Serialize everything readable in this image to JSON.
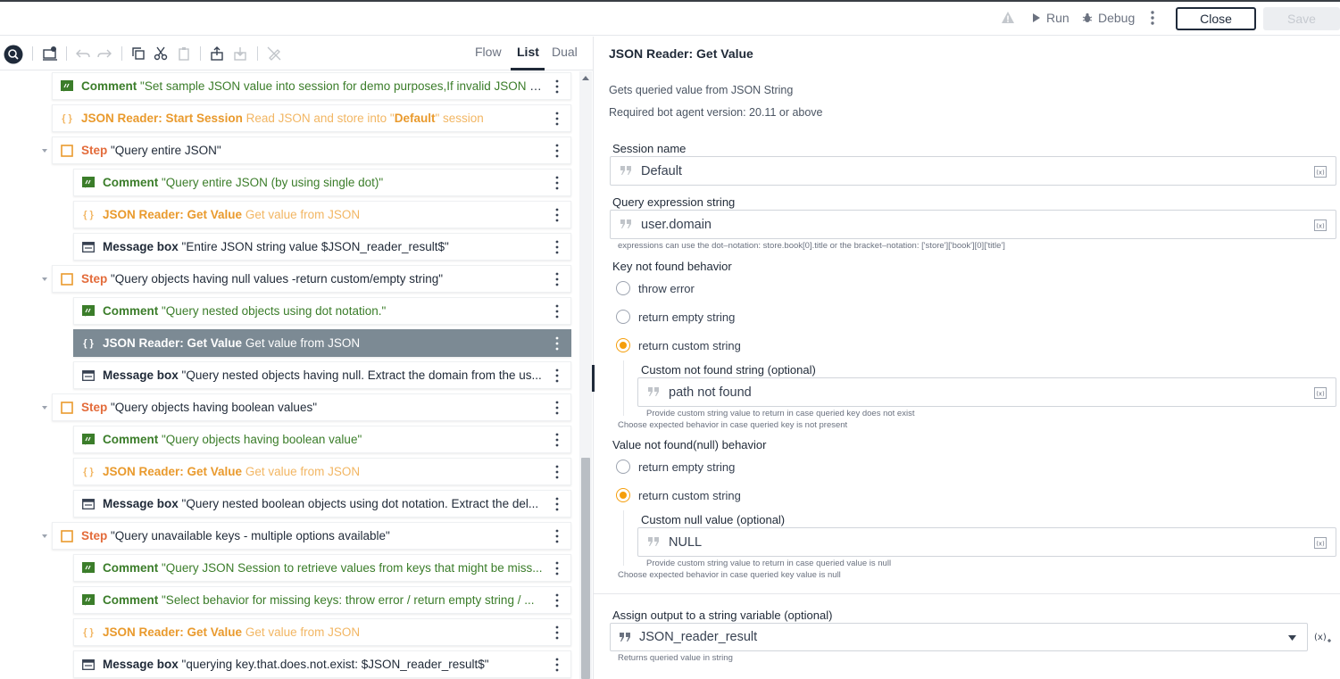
{
  "topbar": {
    "run_label": "Run",
    "debug_label": "Debug",
    "close_label": "Close",
    "save_label": "Save"
  },
  "view_tabs": [
    "Flow",
    "List",
    "Dual"
  ],
  "actions": [
    {
      "type": "comment",
      "label": "Comment",
      "detail": "\"Set sample JSON value into session for demo purposes,If invalid JSON i...\""
    },
    {
      "type": "json",
      "label": "JSON Reader: Start Session",
      "detail_pre": " Read JSON and store into \"",
      "detail_bold": "Default",
      "detail_post": "\" session"
    },
    {
      "type": "step",
      "label": "Step",
      "detail": " \"Query entire JSON\""
    },
    {
      "type": "comment",
      "label": "Comment",
      "detail": " \"Query entire JSON (by using single dot)\""
    },
    {
      "type": "json",
      "label": "JSON Reader: Get Value",
      "detail": " Get value from JSON"
    },
    {
      "type": "msg",
      "label": "Message box",
      "detail": " \"Entire JSON string value $JSON_reader_result$\""
    },
    {
      "type": "step",
      "label": "Step",
      "detail": " \"Query objects having null values -return custom/empty string\""
    },
    {
      "type": "comment",
      "label": "Comment",
      "detail": " \"Query nested objects using dot notation.\""
    },
    {
      "type": "json-selected",
      "label": "JSON Reader: Get Value",
      "detail": " Get value from JSON"
    },
    {
      "type": "msg",
      "label": "Message box",
      "detail": " \"Query nested objects having null. Extract the domain from the us..."
    },
    {
      "type": "step",
      "label": "Step",
      "detail": " \"Query objects having boolean values\""
    },
    {
      "type": "comment",
      "label": "Comment",
      "detail": " \"Query objects having boolean value\""
    },
    {
      "type": "json",
      "label": "JSON Reader: Get Value",
      "detail": " Get value from JSON"
    },
    {
      "type": "msg",
      "label": "Message box",
      "detail": " \"Query nested boolean objects using dot notation. Extract the del..."
    },
    {
      "type": "step",
      "label": "Step",
      "detail": " \"Query unavailable keys - multiple options available\""
    },
    {
      "type": "comment",
      "label": "Comment",
      "detail": " \"Query JSON Session to retrieve values from keys that might be miss..."
    },
    {
      "type": "comment",
      "label": "Comment",
      "detail": " \"Select behavior for missing keys: throw error / return empty string / ..."
    },
    {
      "type": "json",
      "label": "JSON Reader: Get Value",
      "detail": " Get value from JSON"
    },
    {
      "type": "msg",
      "label": "Message box",
      "detail": " \"querying key.that.does.not.exist: $JSON_reader_result$\""
    }
  ],
  "panel": {
    "title": "JSON Reader: Get Value",
    "desc1": "Gets queried value from JSON String",
    "desc2": "Required bot agent version: 20.11 or above",
    "session_label": "Session name",
    "session_value": "Default",
    "query_label": "Query expression string",
    "query_value": "user.domain",
    "query_hint": "expressions can use the dot–notation: store.book[0].title or the bracket–notation: ['store']['book'][0]['title']",
    "key_nf_label": "Key not found behavior",
    "key_nf_options": [
      "throw error",
      "return empty string",
      "return custom string"
    ],
    "custom_nf_label": "Custom not found string (optional)",
    "custom_nf_value": "path not found",
    "custom_nf_hint": "Provide custom string value to return in case queried key does not exist",
    "key_nf_hint": "Choose expected behavior in case queried key is not present",
    "null_label": "Value not found(null) behavior",
    "null_options": [
      "return empty string",
      "return custom string"
    ],
    "custom_null_label": "Custom null value (optional)",
    "custom_null_value": "NULL",
    "custom_null_hint": "Provide custom string value to return in case queried value is null",
    "null_hint": "Choose expected behavior in case queried key value is null",
    "output_label": "Assign output to a string variable (optional)",
    "output_value": "JSON_reader_result",
    "output_hint": "Returns queried value in string"
  },
  "icons": {
    "comment": "comment-icon",
    "json": "braces-icon",
    "step": "step-icon",
    "msg": "message-box-icon"
  },
  "colors": {
    "comment": "#3b7d2a",
    "json": "#e99a2d",
    "step": "#e36b3a",
    "selected": "#7c8a94",
    "radio_on": "#f59e0b"
  }
}
